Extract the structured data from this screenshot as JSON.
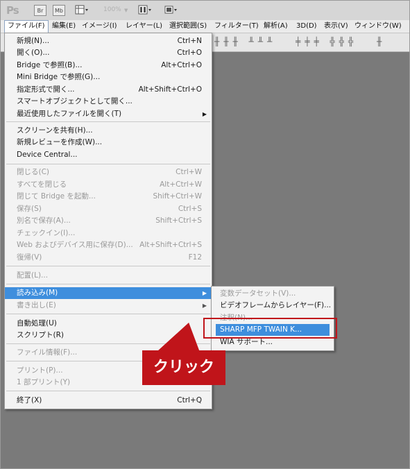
{
  "app": {
    "logo": "Ps",
    "br_button": "Br",
    "mb_button": "Mb",
    "zoom": "100%"
  },
  "menubar": {
    "items": [
      "ファイル(F)",
      "編集(E)",
      "イメージ(I)",
      "レイヤー(L)",
      "選択範囲(S)",
      "フィルター(T)",
      "解析(A)",
      "3D(D)",
      "表示(V)",
      "ウィンドウ(W)"
    ]
  },
  "file_menu": {
    "items": [
      {
        "label": "新規(N)...",
        "shortcut": "Ctrl+N",
        "disabled": false
      },
      {
        "label": "開く(O)...",
        "shortcut": "Ctrl+O",
        "disabled": false
      },
      {
        "label": "Bridge で参照(B)...",
        "shortcut": "Alt+Ctrl+O",
        "disabled": false
      },
      {
        "label": "Mini Bridge で参照(G)...",
        "shortcut": "",
        "disabled": false
      },
      {
        "label": "指定形式で開く...",
        "shortcut": "Alt+Shift+Ctrl+O",
        "disabled": false
      },
      {
        "label": "スマートオブジェクトとして開く...",
        "shortcut": "",
        "disabled": false
      },
      {
        "label": "最近使用したファイルを開く(T)",
        "shortcut": "",
        "disabled": false,
        "submenu": true
      },
      {
        "label": "スクリーンを共有(H)...",
        "shortcut": "",
        "disabled": false
      },
      {
        "label": "新規レビューを作成(W)...",
        "shortcut": "",
        "disabled": false
      },
      {
        "label": "Device Central...",
        "shortcut": "",
        "disabled": false
      },
      {
        "label": "閉じる(C)",
        "shortcut": "Ctrl+W",
        "disabled": true
      },
      {
        "label": "すべてを閉じる",
        "shortcut": "Alt+Ctrl+W",
        "disabled": true
      },
      {
        "label": "閉じて Bridge を起動...",
        "shortcut": "Shift+Ctrl+W",
        "disabled": true
      },
      {
        "label": "保存(S)",
        "shortcut": "Ctrl+S",
        "disabled": true
      },
      {
        "label": "別名で保存(A)...",
        "shortcut": "Shift+Ctrl+S",
        "disabled": true
      },
      {
        "label": "チェックイン(I)...",
        "shortcut": "",
        "disabled": true
      },
      {
        "label": "Web およびデバイス用に保存(D)...",
        "shortcut": "Alt+Shift+Ctrl+S",
        "disabled": true
      },
      {
        "label": "復帰(V)",
        "shortcut": "F12",
        "disabled": true
      },
      {
        "label": "配置(L)...",
        "shortcut": "",
        "disabled": true
      },
      {
        "label": "読み込み(M)",
        "shortcut": "",
        "disabled": false,
        "submenu": true,
        "highlighted": true
      },
      {
        "label": "書き出し(E)",
        "shortcut": "",
        "disabled": true,
        "submenu": true
      },
      {
        "label": "自動処理(U)",
        "shortcut": "",
        "disabled": false
      },
      {
        "label": "スクリプト(R)",
        "shortcut": "",
        "disabled": false
      },
      {
        "label": "ファイル情報(F)...",
        "shortcut": "",
        "disabled": true
      },
      {
        "label": "プリント(P)...",
        "shortcut": "",
        "disabled": true
      },
      {
        "label": "1 部プリント(Y)",
        "shortcut": "",
        "disabled": true
      },
      {
        "label": "終了(X)",
        "shortcut": "Ctrl+Q",
        "disabled": false
      }
    ]
  },
  "import_submenu": {
    "items": [
      {
        "label": "変数データセット(V)...",
        "disabled": true
      },
      {
        "label": "ビデオフレームからレイヤー(F)...",
        "disabled": false
      },
      {
        "label": "注釈(N)...",
        "disabled": true
      },
      {
        "label": "SHARP MFP TWAIN K...",
        "disabled": false,
        "highlighted": true
      },
      {
        "label": "WIA サポート...",
        "disabled": false
      }
    ]
  },
  "callout": {
    "text": "クリック",
    "color": "#c0141a"
  },
  "colors": {
    "highlight": "#3e8edd",
    "canvas": "#7a7a7a"
  }
}
